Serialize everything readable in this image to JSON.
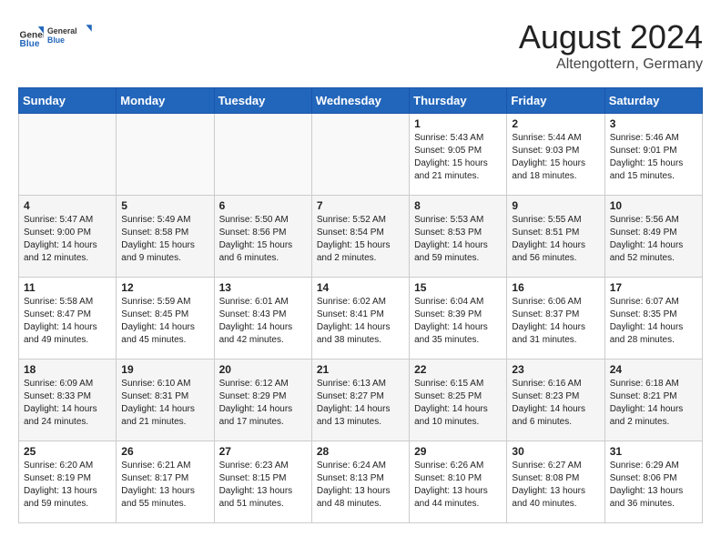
{
  "logo": {
    "general": "General",
    "blue": "Blue"
  },
  "title": {
    "month": "August 2024",
    "location": "Altengottern, Germany"
  },
  "weekdays": [
    "Sunday",
    "Monday",
    "Tuesday",
    "Wednesday",
    "Thursday",
    "Friday",
    "Saturday"
  ],
  "weeks": [
    [
      {
        "day": "",
        "info": ""
      },
      {
        "day": "",
        "info": ""
      },
      {
        "day": "",
        "info": ""
      },
      {
        "day": "",
        "info": ""
      },
      {
        "day": "1",
        "sunrise": "5:43 AM",
        "sunset": "9:05 PM",
        "daylight": "15 hours and 21 minutes."
      },
      {
        "day": "2",
        "sunrise": "5:44 AM",
        "sunset": "9:03 PM",
        "daylight": "15 hours and 18 minutes."
      },
      {
        "day": "3",
        "sunrise": "5:46 AM",
        "sunset": "9:01 PM",
        "daylight": "15 hours and 15 minutes."
      }
    ],
    [
      {
        "day": "4",
        "sunrise": "5:47 AM",
        "sunset": "9:00 PM",
        "daylight": "14 hours and 12 minutes."
      },
      {
        "day": "5",
        "sunrise": "5:49 AM",
        "sunset": "8:58 PM",
        "daylight": "15 hours and 9 minutes."
      },
      {
        "day": "6",
        "sunrise": "5:50 AM",
        "sunset": "8:56 PM",
        "daylight": "15 hours and 6 minutes."
      },
      {
        "day": "7",
        "sunrise": "5:52 AM",
        "sunset": "8:54 PM",
        "daylight": "15 hours and 2 minutes."
      },
      {
        "day": "8",
        "sunrise": "5:53 AM",
        "sunset": "8:53 PM",
        "daylight": "14 hours and 59 minutes."
      },
      {
        "day": "9",
        "sunrise": "5:55 AM",
        "sunset": "8:51 PM",
        "daylight": "14 hours and 56 minutes."
      },
      {
        "day": "10",
        "sunrise": "5:56 AM",
        "sunset": "8:49 PM",
        "daylight": "14 hours and 52 minutes."
      }
    ],
    [
      {
        "day": "11",
        "sunrise": "5:58 AM",
        "sunset": "8:47 PM",
        "daylight": "14 hours and 49 minutes."
      },
      {
        "day": "12",
        "sunrise": "5:59 AM",
        "sunset": "8:45 PM",
        "daylight": "14 hours and 45 minutes."
      },
      {
        "day": "13",
        "sunrise": "6:01 AM",
        "sunset": "8:43 PM",
        "daylight": "14 hours and 42 minutes."
      },
      {
        "day": "14",
        "sunrise": "6:02 AM",
        "sunset": "8:41 PM",
        "daylight": "14 hours and 38 minutes."
      },
      {
        "day": "15",
        "sunrise": "6:04 AM",
        "sunset": "8:39 PM",
        "daylight": "14 hours and 35 minutes."
      },
      {
        "day": "16",
        "sunrise": "6:06 AM",
        "sunset": "8:37 PM",
        "daylight": "14 hours and 31 minutes."
      },
      {
        "day": "17",
        "sunrise": "6:07 AM",
        "sunset": "8:35 PM",
        "daylight": "14 hours and 28 minutes."
      }
    ],
    [
      {
        "day": "18",
        "sunrise": "6:09 AM",
        "sunset": "8:33 PM",
        "daylight": "14 hours and 24 minutes."
      },
      {
        "day": "19",
        "sunrise": "6:10 AM",
        "sunset": "8:31 PM",
        "daylight": "14 hours and 21 minutes."
      },
      {
        "day": "20",
        "sunrise": "6:12 AM",
        "sunset": "8:29 PM",
        "daylight": "14 hours and 17 minutes."
      },
      {
        "day": "21",
        "sunrise": "6:13 AM",
        "sunset": "8:27 PM",
        "daylight": "14 hours and 13 minutes."
      },
      {
        "day": "22",
        "sunrise": "6:15 AM",
        "sunset": "8:25 PM",
        "daylight": "14 hours and 10 minutes."
      },
      {
        "day": "23",
        "sunrise": "6:16 AM",
        "sunset": "8:23 PM",
        "daylight": "14 hours and 6 minutes."
      },
      {
        "day": "24",
        "sunrise": "6:18 AM",
        "sunset": "8:21 PM",
        "daylight": "14 hours and 2 minutes."
      }
    ],
    [
      {
        "day": "25",
        "sunrise": "6:20 AM",
        "sunset": "8:19 PM",
        "daylight": "13 hours and 59 minutes."
      },
      {
        "day": "26",
        "sunrise": "6:21 AM",
        "sunset": "8:17 PM",
        "daylight": "13 hours and 55 minutes."
      },
      {
        "day": "27",
        "sunrise": "6:23 AM",
        "sunset": "8:15 PM",
        "daylight": "13 hours and 51 minutes."
      },
      {
        "day": "28",
        "sunrise": "6:24 AM",
        "sunset": "8:13 PM",
        "daylight": "13 hours and 48 minutes."
      },
      {
        "day": "29",
        "sunrise": "6:26 AM",
        "sunset": "8:10 PM",
        "daylight": "13 hours and 44 minutes."
      },
      {
        "day": "30",
        "sunrise": "6:27 AM",
        "sunset": "8:08 PM",
        "daylight": "13 hours and 40 minutes."
      },
      {
        "day": "31",
        "sunrise": "6:29 AM",
        "sunset": "8:06 PM",
        "daylight": "13 hours and 36 minutes."
      }
    ]
  ]
}
